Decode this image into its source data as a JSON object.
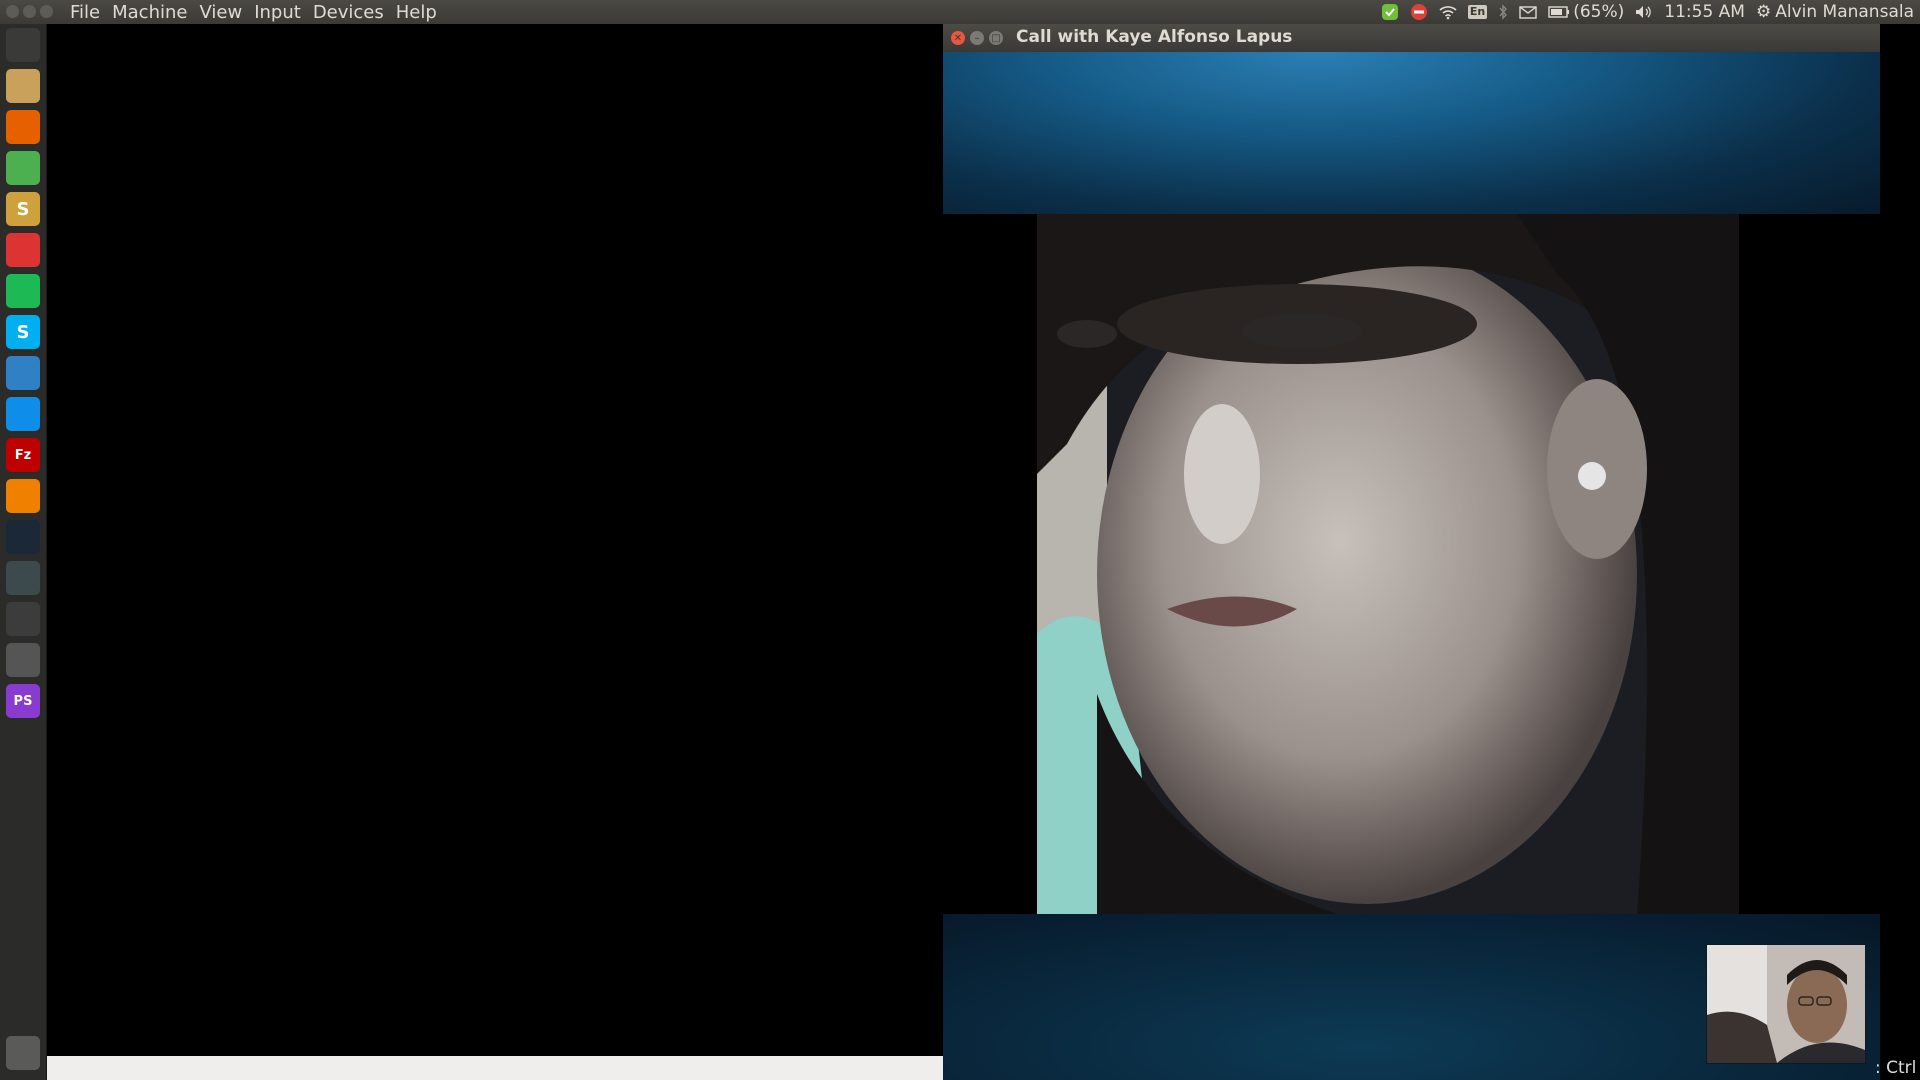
{
  "menubar": {
    "items": [
      "File",
      "Machine",
      "View",
      "Input",
      "Devices",
      "Help"
    ]
  },
  "tray": {
    "keyboard_layout": "En",
    "battery": "(65%)",
    "time": "11:55 AM",
    "user": "Alvin Manansala"
  },
  "launcher": {
    "apps": [
      {
        "name": "ubuntu-dash",
        "color": "#3a3a38"
      },
      {
        "name": "files",
        "color": "#c9a15a"
      },
      {
        "name": "firefox",
        "color": "#e66000"
      },
      {
        "name": "chrome",
        "color": "#4caf50"
      },
      {
        "name": "sublime-text",
        "color": "#cfa13c",
        "glyph": "S"
      },
      {
        "name": "system-settings",
        "color": "#d33"
      },
      {
        "name": "spotify",
        "color": "#1db954"
      },
      {
        "name": "skype",
        "color": "#00aff0",
        "glyph": "S"
      },
      {
        "name": "system-monitor",
        "color": "#2f80c4"
      },
      {
        "name": "teamviewer",
        "color": "#0e8ee9"
      },
      {
        "name": "filezilla",
        "color": "#bf0000",
        "glyph": "Fz"
      },
      {
        "name": "vlc",
        "color": "#f08000"
      },
      {
        "name": "steam",
        "color": "#1b2838"
      },
      {
        "name": "activity-monitor",
        "color": "#3d4a4d"
      },
      {
        "name": "terminal",
        "color": "#3c3c3c"
      },
      {
        "name": "workspace",
        "color": "#555"
      },
      {
        "name": "phpstorm",
        "color": "#8a3bcf",
        "glyph": "PS"
      },
      {
        "name": "trash",
        "color": "#5a5a58"
      }
    ]
  },
  "call_window": {
    "title": "Call with Kaye Alfonso Lapus"
  },
  "host_key_label": "Ctrl"
}
